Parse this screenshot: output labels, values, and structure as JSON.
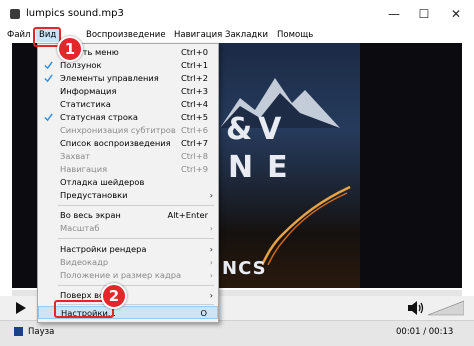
{
  "window": {
    "title": "lumpics sound.mp3",
    "minimize": "—",
    "maximize": "☐",
    "close": "✕"
  },
  "menubar": {
    "items": [
      "Файл",
      "Вид",
      "Воспроизведение",
      "Навигация",
      "Закладки",
      "Помощь"
    ]
  },
  "view_menu": {
    "items": [
      {
        "label": "Скрыть меню",
        "shortcut": "Ctrl+0",
        "checked": false
      },
      {
        "label": "Ползунок",
        "shortcut": "Ctrl+1",
        "checked": true
      },
      {
        "label": "Элементы управления",
        "shortcut": "Ctrl+2",
        "checked": true
      },
      {
        "label": "Информация",
        "shortcut": "Ctrl+3",
        "checked": false
      },
      {
        "label": "Статистика",
        "shortcut": "Ctrl+4",
        "checked": false
      },
      {
        "label": "Статусная строка",
        "shortcut": "Ctrl+5",
        "checked": true
      },
      {
        "label": "Синхронизация субтитров",
        "shortcut": "Ctrl+6",
        "disabled": true
      },
      {
        "label": "Список воспроизведения",
        "shortcut": "Ctrl+7"
      },
      {
        "label": "Захват",
        "shortcut": "Ctrl+8",
        "disabled": true
      },
      {
        "label": "Навигация",
        "shortcut": "Ctrl+9",
        "disabled": true
      },
      {
        "label": "Отладка шейдеров"
      },
      {
        "label": "Предустановки",
        "submenu": true
      },
      {
        "label": "Во весь экран",
        "shortcut": "Alt+Enter"
      },
      {
        "label": "Масштаб",
        "submenu": true,
        "disabled": true
      },
      {
        "label": "Настройки рендера",
        "submenu": true
      },
      {
        "label": "Видеокадр",
        "submenu": true,
        "disabled": true
      },
      {
        "label": "Положение и размер кадра",
        "submenu": true,
        "disabled": true
      },
      {
        "label": "Поверх всех",
        "submenu": true
      },
      {
        "label": "Настройки...",
        "shortcut": "O",
        "highlighted": true
      }
    ]
  },
  "video": {
    "title_line1": "&V",
    "title_line2": "NE",
    "logo_text": "NCS"
  },
  "controls": {
    "play_icon": "play-icon",
    "volume_icon": "volume-icon"
  },
  "status": {
    "state": "Пауза",
    "time": "00:01 / 00:13"
  },
  "callouts": {
    "step1": "1",
    "step2": "2"
  },
  "colors": {
    "accent": "#e4262b",
    "highlight": "#cce4f7",
    "check": "#2f8de4"
  }
}
